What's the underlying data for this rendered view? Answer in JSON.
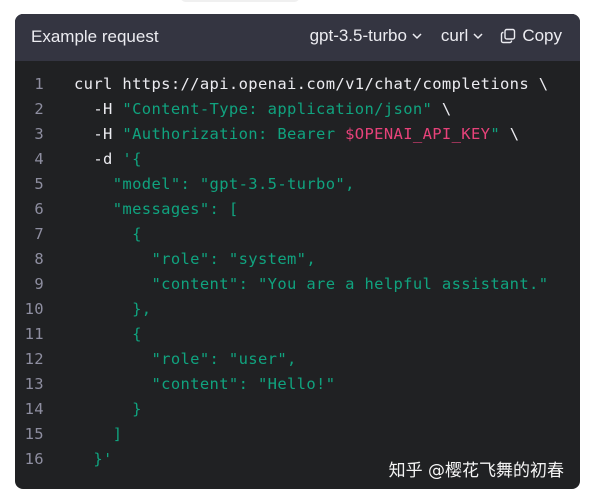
{
  "header": {
    "title": "Example request",
    "model_label": "gpt-3.5-turbo",
    "language_label": "curl",
    "copy_label": "Copy"
  },
  "code_lines": [
    {
      "num": "1",
      "parts": [
        {
          "t": "curl https://api.openai.com/v1/chat/completions \\",
          "c": ""
        }
      ]
    },
    {
      "num": "2",
      "parts": [
        {
          "t": "  -H ",
          "c": ""
        },
        {
          "t": "\"Content-Type: application/json\"",
          "c": "str"
        },
        {
          "t": " \\",
          "c": ""
        }
      ]
    },
    {
      "num": "3",
      "parts": [
        {
          "t": "  -H ",
          "c": ""
        },
        {
          "t": "\"Authorization: Bearer ",
          "c": "str"
        },
        {
          "t": "$OPENAI_API_KEY",
          "c": "var"
        },
        {
          "t": "\"",
          "c": "str"
        },
        {
          "t": " \\",
          "c": ""
        }
      ]
    },
    {
      "num": "4",
      "parts": [
        {
          "t": "  -d ",
          "c": ""
        },
        {
          "t": "'{",
          "c": "str"
        }
      ]
    },
    {
      "num": "5",
      "parts": [
        {
          "t": "    \"model\": \"gpt-3.5-turbo\",",
          "c": "str"
        }
      ]
    },
    {
      "num": "6",
      "parts": [
        {
          "t": "    \"messages\": [",
          "c": "str"
        }
      ]
    },
    {
      "num": "7",
      "parts": [
        {
          "t": "      {",
          "c": "str"
        }
      ]
    },
    {
      "num": "8",
      "parts": [
        {
          "t": "        \"role\": \"system\",",
          "c": "str"
        }
      ]
    },
    {
      "num": "9",
      "parts": [
        {
          "t": "        \"content\": \"You are a helpful assistant.\"",
          "c": "str"
        }
      ]
    },
    {
      "num": "10",
      "parts": [
        {
          "t": "      },",
          "c": "str"
        }
      ]
    },
    {
      "num": "11",
      "parts": [
        {
          "t": "      {",
          "c": "str"
        }
      ]
    },
    {
      "num": "12",
      "parts": [
        {
          "t": "        \"role\": \"user\",",
          "c": "str"
        }
      ]
    },
    {
      "num": "13",
      "parts": [
        {
          "t": "        \"content\": \"Hello!\"",
          "c": "str"
        }
      ]
    },
    {
      "num": "14",
      "parts": [
        {
          "t": "      }",
          "c": "str"
        }
      ]
    },
    {
      "num": "15",
      "parts": [
        {
          "t": "    ]",
          "c": "str"
        }
      ]
    },
    {
      "num": "16",
      "parts": [
        {
          "t": "  }'",
          "c": "str"
        }
      ]
    }
  ],
  "watermark": "知乎 @樱花飞舞的初春",
  "colors": {
    "background": "#202123",
    "header": "#343541",
    "text": "#ececf1",
    "line_number": "#8e8ea0",
    "string": "#10a37f",
    "variable": "#e7427a"
  },
  "icons": {
    "dropdown": "chevron-down-icon",
    "copy": "copy-icon"
  }
}
